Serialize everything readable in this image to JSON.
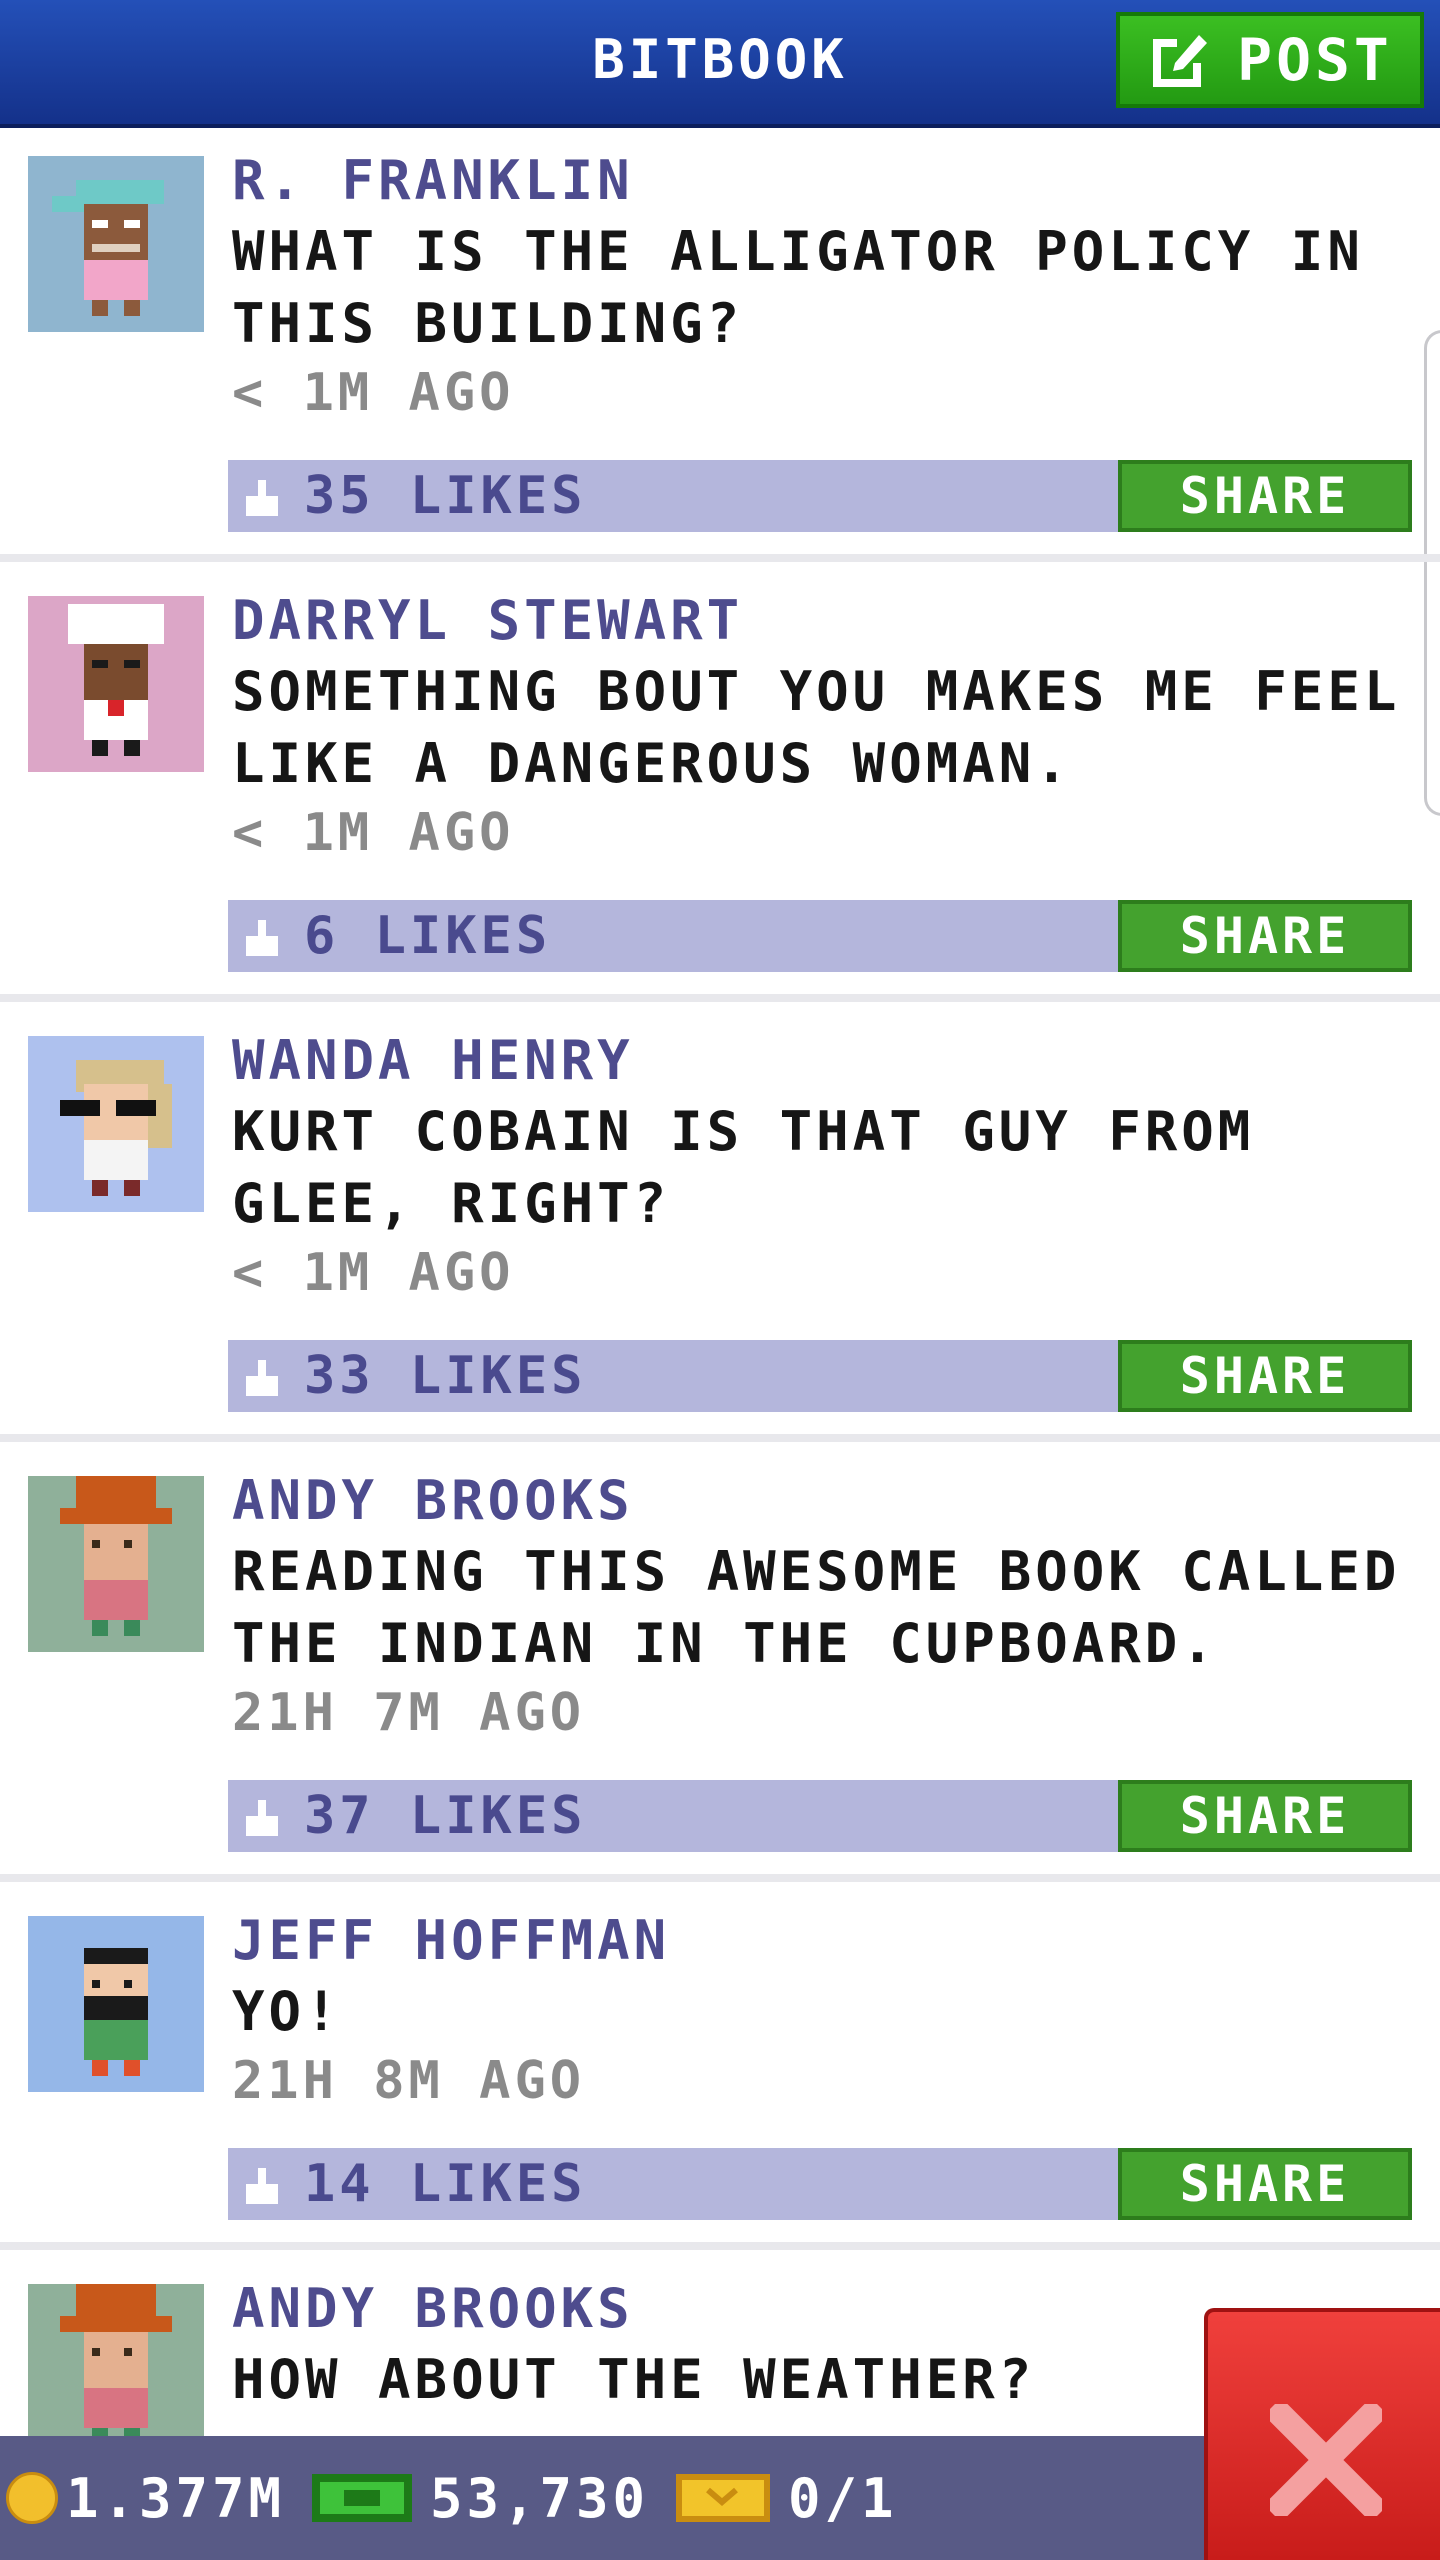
{
  "header": {
    "title": "BITBOOK",
    "post_label": "POST"
  },
  "posts": [
    {
      "author": "R. FRANKLIN",
      "message": "WHAT IS THE ALLIGATOR POLICY IN THIS BUILDING?",
      "time": "< 1M AGO",
      "likes": "35 LIKES",
      "share_label": "SHARE",
      "avatar_bg": "#8fb5cf"
    },
    {
      "author": "DARRYL STEWART",
      "message": "SOMETHING BOUT YOU MAKES ME FEEL LIKE A DANGEROUS WOMAN.",
      "time": "< 1M AGO",
      "likes": "6 LIKES",
      "share_label": "SHARE",
      "avatar_bg": "#dca6c7"
    },
    {
      "author": "WANDA HENRY",
      "message": "KURT COBAIN IS THAT GUY FROM GLEE, RIGHT?",
      "time": "< 1M AGO",
      "likes": "33 LIKES",
      "share_label": "SHARE",
      "avatar_bg": "#aec1ee"
    },
    {
      "author": "ANDY BROOKS",
      "message": "READING THIS AWESOME BOOK CALLED THE INDIAN IN THE CUPBOARD.",
      "time": "21H 7M AGO",
      "likes": "37 LIKES",
      "share_label": "SHARE",
      "avatar_bg": "#8fb09a"
    },
    {
      "author": "JEFF HOFFMAN",
      "message": "YO!",
      "time": "21H 8M AGO",
      "likes": "14 LIKES",
      "share_label": "SHARE",
      "avatar_bg": "#95b7e8"
    },
    {
      "author": "ANDY BROOKS",
      "message": "HOW ABOUT THE WEATHER?",
      "avatar_bg": "#8fb09a"
    }
  ],
  "status_bar": {
    "coins": "1.377M",
    "bux": "53,730",
    "tickets": "0/1"
  },
  "colors": {
    "header": "#1f44a8",
    "post_button": "#2fb21a",
    "share_button": "#44a22e",
    "like_bar": "#b4b6dc",
    "close_button": "#e02e2a"
  },
  "icons": {
    "post": "edit-icon",
    "like": "thumbs-up-icon",
    "coin": "coin-icon",
    "bux": "bux-icon",
    "ticket": "ticket-icon",
    "close": "close-icon"
  }
}
